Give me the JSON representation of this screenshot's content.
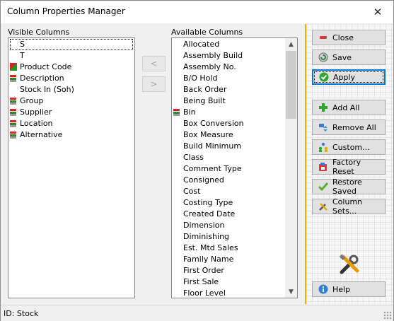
{
  "window": {
    "title": "Column Properties Manager"
  },
  "visible_columns": {
    "label": "Visible Columns",
    "items": [
      {
        "text": "S",
        "icon": "none"
      },
      {
        "text": "T",
        "icon": "none"
      },
      {
        "text": "Product Code",
        "icon": "slash"
      },
      {
        "text": "Description",
        "icon": "ab"
      },
      {
        "text": "Stock In (Soh)",
        "icon": "none"
      },
      {
        "text": "Group",
        "icon": "ab"
      },
      {
        "text": "Supplier",
        "icon": "ab"
      },
      {
        "text": "Location",
        "icon": "ab"
      },
      {
        "text": "Alternative",
        "icon": "ab"
      }
    ]
  },
  "move_buttons": {
    "left": "<",
    "right": ">"
  },
  "available_columns": {
    "label": "Available Columns",
    "items": [
      {
        "text": "Allocated",
        "icon": "none"
      },
      {
        "text": "Assembly Build",
        "icon": "none"
      },
      {
        "text": "Assembly No.",
        "icon": "none"
      },
      {
        "text": "B/O Hold",
        "icon": "none"
      },
      {
        "text": "Back Order",
        "icon": "none"
      },
      {
        "text": "Being Built",
        "icon": "none"
      },
      {
        "text": "Bin",
        "icon": "ab"
      },
      {
        "text": "Box Conversion",
        "icon": "none"
      },
      {
        "text": "Box Measure",
        "icon": "none"
      },
      {
        "text": "Build Minimum",
        "icon": "none"
      },
      {
        "text": "Class",
        "icon": "none"
      },
      {
        "text": "Comment Type",
        "icon": "none"
      },
      {
        "text": "Consigned",
        "icon": "none"
      },
      {
        "text": "Cost",
        "icon": "none"
      },
      {
        "text": "Costing Type",
        "icon": "none"
      },
      {
        "text": "Created Date",
        "icon": "none"
      },
      {
        "text": "Dimension",
        "icon": "none"
      },
      {
        "text": "Diminishing",
        "icon": "none"
      },
      {
        "text": "Est. Mtd Sales",
        "icon": "none"
      },
      {
        "text": "Family Name",
        "icon": "none"
      },
      {
        "text": "First Order",
        "icon": "none"
      },
      {
        "text": "First Sale",
        "icon": "none"
      },
      {
        "text": "Floor Level",
        "icon": "none"
      }
    ]
  },
  "actions": {
    "close": "Close",
    "save": "Save",
    "apply": "Apply",
    "add_all": "Add All",
    "remove_all": "Remove All",
    "custom": "Custom...",
    "factory_reset": "Factory Reset",
    "restore_saved": "Restore Saved",
    "column_sets": "Column Sets...",
    "help": "Help"
  },
  "status": {
    "text": "ID: Stock"
  },
  "colors": {
    "accent": "#e8b400",
    "focus": "#0078d7"
  }
}
